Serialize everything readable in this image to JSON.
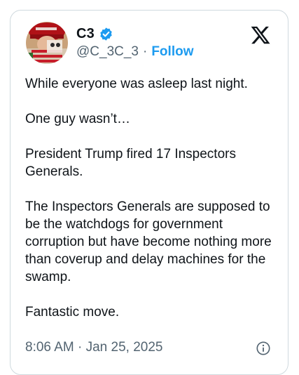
{
  "author": {
    "display_name": "C3",
    "handle": "@C_3C_3",
    "separator": "·",
    "follow_label": "Follow"
  },
  "tweet": {
    "paragraphs": [
      "While everyone was asleep last night.",
      "One guy wasn’t…",
      "President Trump fired 17 Inspectors Generals.",
      "The Inspectors Generals are supposed to be the watchdogs for government corruption but have become nothing more than coverup and delay machines for the swamp.",
      "Fantastic move."
    ],
    "timestamp": "8:06 AM · Jan 25, 2025"
  },
  "icons": {
    "verified": "verified-badge-icon",
    "logo": "x-logo-icon",
    "info": "info-icon"
  },
  "colors": {
    "accent": "#1d9bf0",
    "text": "#0f1419",
    "muted": "#536471",
    "border": "#cfd9de"
  }
}
